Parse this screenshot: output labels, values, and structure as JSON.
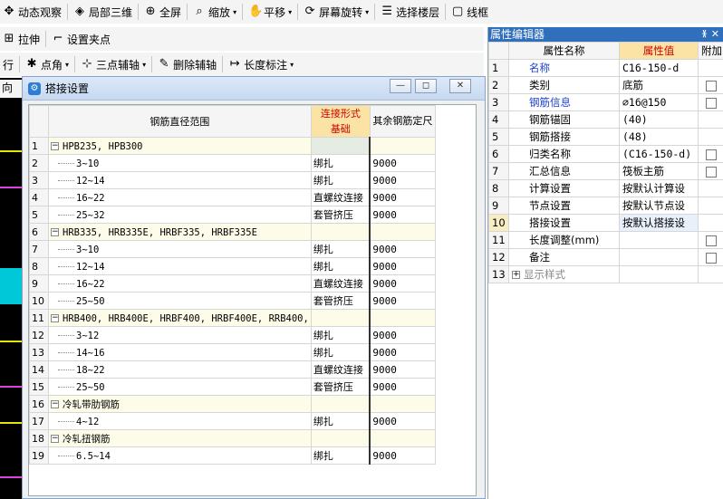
{
  "toolbar1": [
    {
      "icon": "orbit-icon",
      "glyph": "✥",
      "label": "动态观察"
    },
    {
      "icon": "cube-icon",
      "glyph": "◈",
      "label": "局部三维"
    },
    {
      "icon": "fullscreen-icon",
      "glyph": "⊕",
      "label": "全屏"
    },
    {
      "icon": "zoom-icon",
      "glyph": "⌕",
      "label": "缩放",
      "dropdown": "▾"
    },
    {
      "icon": "pan-icon",
      "glyph": "✋",
      "label": "平移",
      "dropdown": "▾"
    },
    {
      "icon": "rotate-icon",
      "glyph": "⟳",
      "label": "屏幕旋转",
      "dropdown": "▾"
    },
    {
      "icon": "floor-icon",
      "glyph": "☰",
      "label": "选择楼层"
    },
    {
      "icon": "wireframe-icon",
      "glyph": "▢",
      "label": "线框"
    }
  ],
  "toolbar2": [
    {
      "icon": "stretch-icon",
      "glyph": "⊞",
      "label": "拉伸"
    },
    {
      "icon": "gripper-icon",
      "glyph": "⌐",
      "label": "设置夹点"
    }
  ],
  "toolbar3": [
    {
      "label": "行"
    },
    {
      "icon": "point-angle-icon",
      "glyph": "✱",
      "label": "点角",
      "dropdown": "▾"
    },
    {
      "icon": "three-point-icon",
      "glyph": "⊹",
      "label": "三点辅轴",
      "dropdown": "▾"
    },
    {
      "icon": "delete-axis-icon",
      "glyph": "✎",
      "label": "删除辅轴"
    },
    {
      "icon": "dimension-icon",
      "glyph": "↦",
      "label": "长度标注",
      "dropdown": "▾"
    }
  ],
  "toolbar4": {
    "label": "向"
  },
  "dialog": {
    "title": "搭接设置",
    "minimize": "—",
    "maximize": "◻",
    "close": "✕",
    "headers": {
      "range": "钢筋直径范围",
      "connect": "连接形式\n基础",
      "other": "其余钢筋定尺"
    },
    "rows": [
      {
        "n": "1",
        "text": "HPB235, HPB300",
        "group": true,
        "connect": "",
        "other": ""
      },
      {
        "n": "2",
        "text": "3~10",
        "connect": "绑扎",
        "other": "9000"
      },
      {
        "n": "3",
        "text": "12~14",
        "connect": "绑扎",
        "other": "9000"
      },
      {
        "n": "4",
        "text": "16~22",
        "connect": "直螺纹连接",
        "other": "9000"
      },
      {
        "n": "5",
        "text": "25~32",
        "connect": "套管挤压",
        "other": "9000"
      },
      {
        "n": "6",
        "text": "HRB335, HRB335E, HRBF335, HRBF335E",
        "group": true,
        "connect": "",
        "other": ""
      },
      {
        "n": "7",
        "text": "3~10",
        "connect": "绑扎",
        "other": "9000"
      },
      {
        "n": "8",
        "text": "12~14",
        "connect": "绑扎",
        "other": "9000"
      },
      {
        "n": "9",
        "text": "16~22",
        "connect": "直螺纹连接",
        "other": "9000"
      },
      {
        "n": "10",
        "text": "25~50",
        "connect": "套管挤压",
        "other": "9000"
      },
      {
        "n": "11",
        "text": "HRB400, HRB400E, HRBF400, HRBF400E, RRB400,",
        "group": true,
        "connect": "",
        "other": ""
      },
      {
        "n": "12",
        "text": "3~12",
        "connect": "绑扎",
        "other": "9000"
      },
      {
        "n": "13",
        "text": "14~16",
        "connect": "绑扎",
        "other": "9000"
      },
      {
        "n": "14",
        "text": "18~22",
        "connect": "直螺纹连接",
        "other": "9000"
      },
      {
        "n": "15",
        "text": "25~50",
        "connect": "套管挤压",
        "other": "9000"
      },
      {
        "n": "16",
        "text": "冷轧带肋钢筋",
        "group": true,
        "connect": "",
        "other": ""
      },
      {
        "n": "17",
        "text": "4~12",
        "connect": "绑扎",
        "other": "9000"
      },
      {
        "n": "18",
        "text": "冷轧扭钢筋",
        "group": true,
        "connect": "",
        "other": ""
      },
      {
        "n": "19",
        "text": "6.5~14",
        "connect": "绑扎",
        "other": "9000"
      }
    ]
  },
  "panel": {
    "title": "属性编辑器",
    "pin": "ᚕ",
    "close": "✕",
    "headers": {
      "name": "属性名称",
      "value": "属性值",
      "extra": "附加"
    },
    "rows": [
      {
        "n": "1",
        "name": "名称",
        "value": "C16-150-d",
        "blue": true,
        "check": false
      },
      {
        "n": "2",
        "name": "类别",
        "value": "底筋",
        "check": true
      },
      {
        "n": "3",
        "name": "钢筋信息",
        "value": "⌀16@150",
        "blue": true,
        "check": true
      },
      {
        "n": "4",
        "name": "钢筋锚固",
        "value": "(40)",
        "check": false
      },
      {
        "n": "5",
        "name": "钢筋搭接",
        "value": "(48)",
        "check": false
      },
      {
        "n": "6",
        "name": "归类名称",
        "value": "(C16-150-d)",
        "check": true
      },
      {
        "n": "7",
        "name": "汇总信息",
        "value": "筏板主筋",
        "check": true
      },
      {
        "n": "8",
        "name": "计算设置",
        "value": "按默认计算设",
        "check": false
      },
      {
        "n": "9",
        "name": "节点设置",
        "value": "按默认节点设",
        "check": false
      },
      {
        "n": "10",
        "name": "搭接设置",
        "value": "按默认搭接设",
        "check": false,
        "selected": true
      },
      {
        "n": "11",
        "name": "长度调整(mm)",
        "value": "",
        "check": true
      },
      {
        "n": "12",
        "name": "备注",
        "value": "",
        "check": true
      },
      {
        "n": "13",
        "name": "显示样式",
        "value": "",
        "check": false,
        "expand": "+",
        "gray": true
      }
    ]
  },
  "colors": {
    "accent": "#2f6fbc",
    "highlight_header": "#fbe3a6",
    "header_text": "#cc0000",
    "link_text": "#1c3fcf"
  }
}
